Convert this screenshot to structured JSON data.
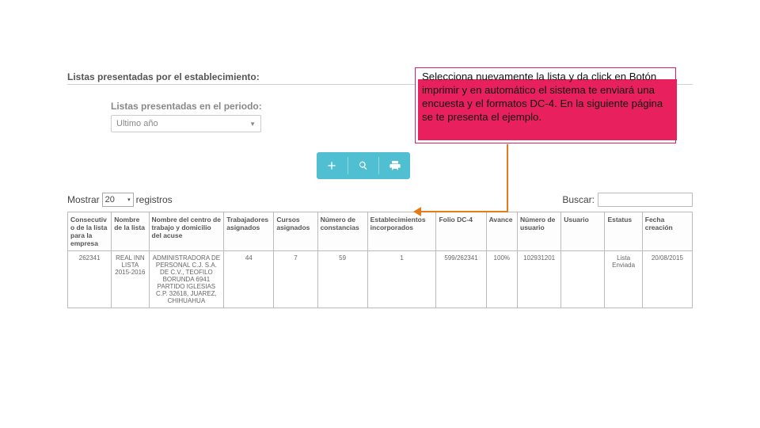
{
  "section_title": "Listas presentadas por el establecimiento:",
  "periodo": {
    "label": "Listas presentadas en el periodo:",
    "selected": "Ultimo año"
  },
  "toolbar": {
    "add": "+",
    "search": "search",
    "print": "print"
  },
  "table_controls": {
    "show_label_pre": "Mostrar",
    "show_value": "20",
    "show_label_post": "registros",
    "search_label": "Buscar:",
    "search_value": ""
  },
  "columns": [
    "Consecutivo de la lista para la empresa",
    "Nombre de la lista",
    "Nombre del centro de trabajo y domicilio del acuse",
    "Trabajadores asignados",
    "Cursos asignados",
    "Número de constancias",
    "Establecimientos incorporados",
    "Folio DC-4",
    "Avance",
    "Número de usuario",
    "Usuario",
    "Estatus",
    "Fecha creación"
  ],
  "rows": [
    {
      "cells": [
        "262341",
        "REAL INN LISTA 2015-2016",
        "ADMINISTRADORA DE PERSONAL C.J. S.A. DE C.V., TEOFILO BORUNDA 6941 PARTIDO IGLESIAS C.P. 32618, JUAREZ, CHIHUAHUA",
        "44",
        "7",
        "59",
        "1",
        "599/262341",
        "100%",
        "102931201",
        "",
        "Lista Enviada",
        "20/08/2015"
      ]
    }
  ],
  "callout": {
    "text": "Selecciona nuevamente la lista y da click en Botón imprimir y en automático el sistema  te enviará una encuesta  y el formatos DC-4. En la siguiente página se te presenta el ejemplo."
  }
}
